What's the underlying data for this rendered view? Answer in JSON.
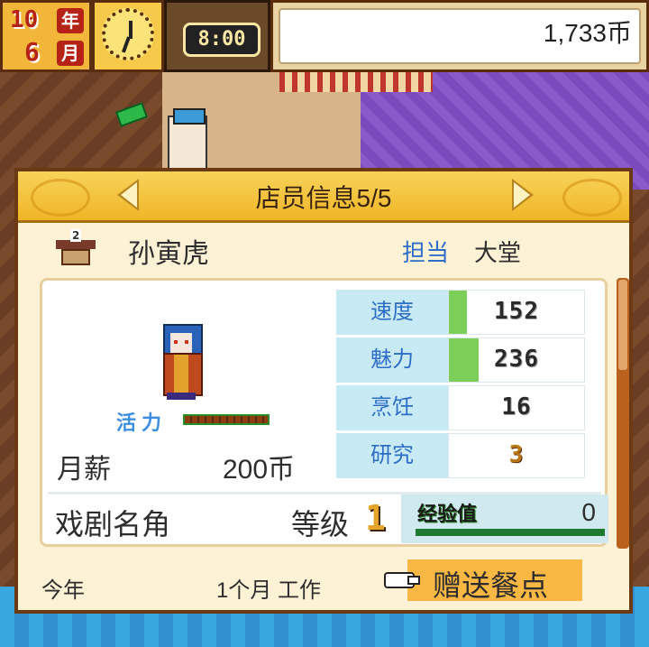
{
  "topbar": {
    "year_num": "10",
    "year_unit": "年",
    "month_num": "6",
    "month_unit": "月",
    "time": "8:00",
    "money": "1,733币"
  },
  "panel": {
    "title": "店员信息5/5",
    "staff": {
      "rank": "2",
      "name": "孙寅虎",
      "role_label": "担当",
      "role_value": "大堂"
    },
    "vitality_label": "活力",
    "vitality_level": 1.0,
    "salary_label": "月薪",
    "salary_value": "200币",
    "stats": [
      {
        "name": "速度",
        "value": "152",
        "fill_pct": 0.13
      },
      {
        "name": "魅力",
        "value": "236",
        "fill_pct": 0.22
      },
      {
        "name": "烹饪",
        "value": "16",
        "fill_pct": 0
      },
      {
        "name": "研究",
        "value": "3",
        "fill_pct": 0
      }
    ],
    "title_name": "戏剧名角",
    "level_label": "等级",
    "level_value": "1",
    "exp_label": "经验值",
    "exp_value": "0",
    "this_year": "今年",
    "work_duration": "1个月 工作",
    "gift_button": "赠送餐点"
  },
  "colors": {
    "accent_gold": "#f0b526",
    "stat_label_bg": "#c8eaf4",
    "stat_fill": "#7cd05a",
    "label_blue": "#2e6ec8",
    "gift_btn": "#f9b744"
  },
  "icons": {
    "prev": "arrow-left-icon",
    "next": "arrow-right-icon",
    "rank": "building-icon",
    "clock": "clock-icon",
    "gift": "pointing-hand-icon"
  }
}
